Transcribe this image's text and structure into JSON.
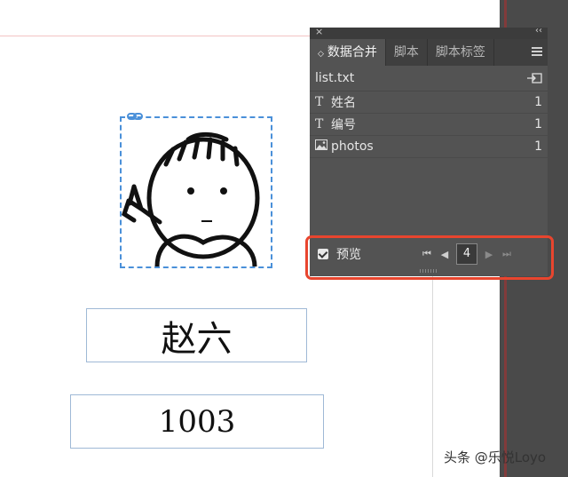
{
  "panel": {
    "close_glyph": "×",
    "collapse_glyph": "‹‹",
    "tabs": [
      {
        "label": "数据合并",
        "active": true
      },
      {
        "label": "脚本",
        "active": false
      },
      {
        "label": "脚本标签",
        "active": false
      }
    ],
    "source_file": "list.txt",
    "fields": [
      {
        "type_glyph": "T",
        "name": "姓名",
        "count": "1"
      },
      {
        "type_glyph": "T",
        "name": "编号",
        "count": "1"
      },
      {
        "type_glyph": "image",
        "name": "photos",
        "count": "1"
      }
    ],
    "preview_label": "预览",
    "preview_checked": true,
    "record_number": "4"
  },
  "canvas": {
    "name_text": "赵六",
    "number_text": "1003"
  },
  "watermark": "头条 @乐悦Loyo",
  "colors": {
    "highlight": "#e8452e",
    "frame_selection": "#4a90d9"
  }
}
